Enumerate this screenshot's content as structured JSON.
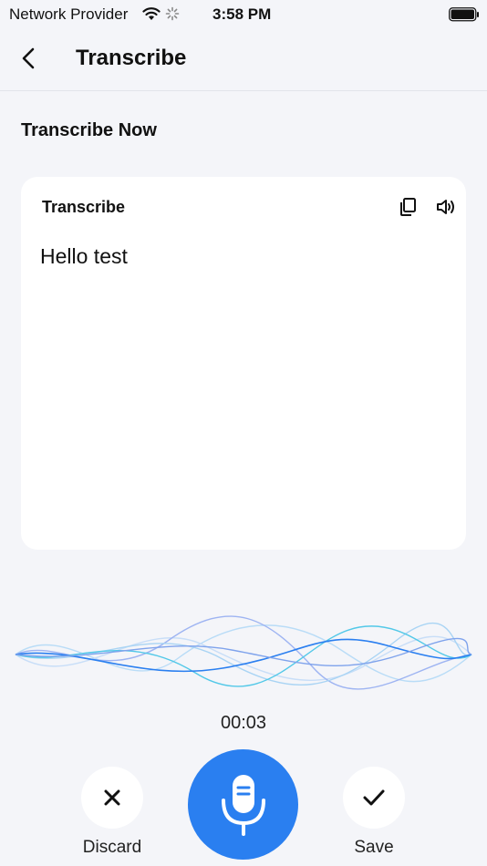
{
  "status_bar": {
    "carrier": "Network Provider",
    "time": "3:58 PM",
    "icons": [
      "wifi-icon",
      "loading-spinner-icon",
      "battery-icon"
    ]
  },
  "header": {
    "title": "Transcribe",
    "back_icon": "chevron-left-icon"
  },
  "section": {
    "title": "Transcribe Now"
  },
  "card": {
    "title": "Transcribe",
    "text": "Hello test",
    "icons": [
      "copy-icon",
      "speaker-icon"
    ]
  },
  "recorder": {
    "timer": "00:03",
    "discard_label": "Discard",
    "save_label": "Save",
    "mic_icon": "microphone-icon"
  },
  "colors": {
    "accent": "#2a7ff0",
    "background": "#f4f5f9",
    "card": "#ffffff"
  }
}
